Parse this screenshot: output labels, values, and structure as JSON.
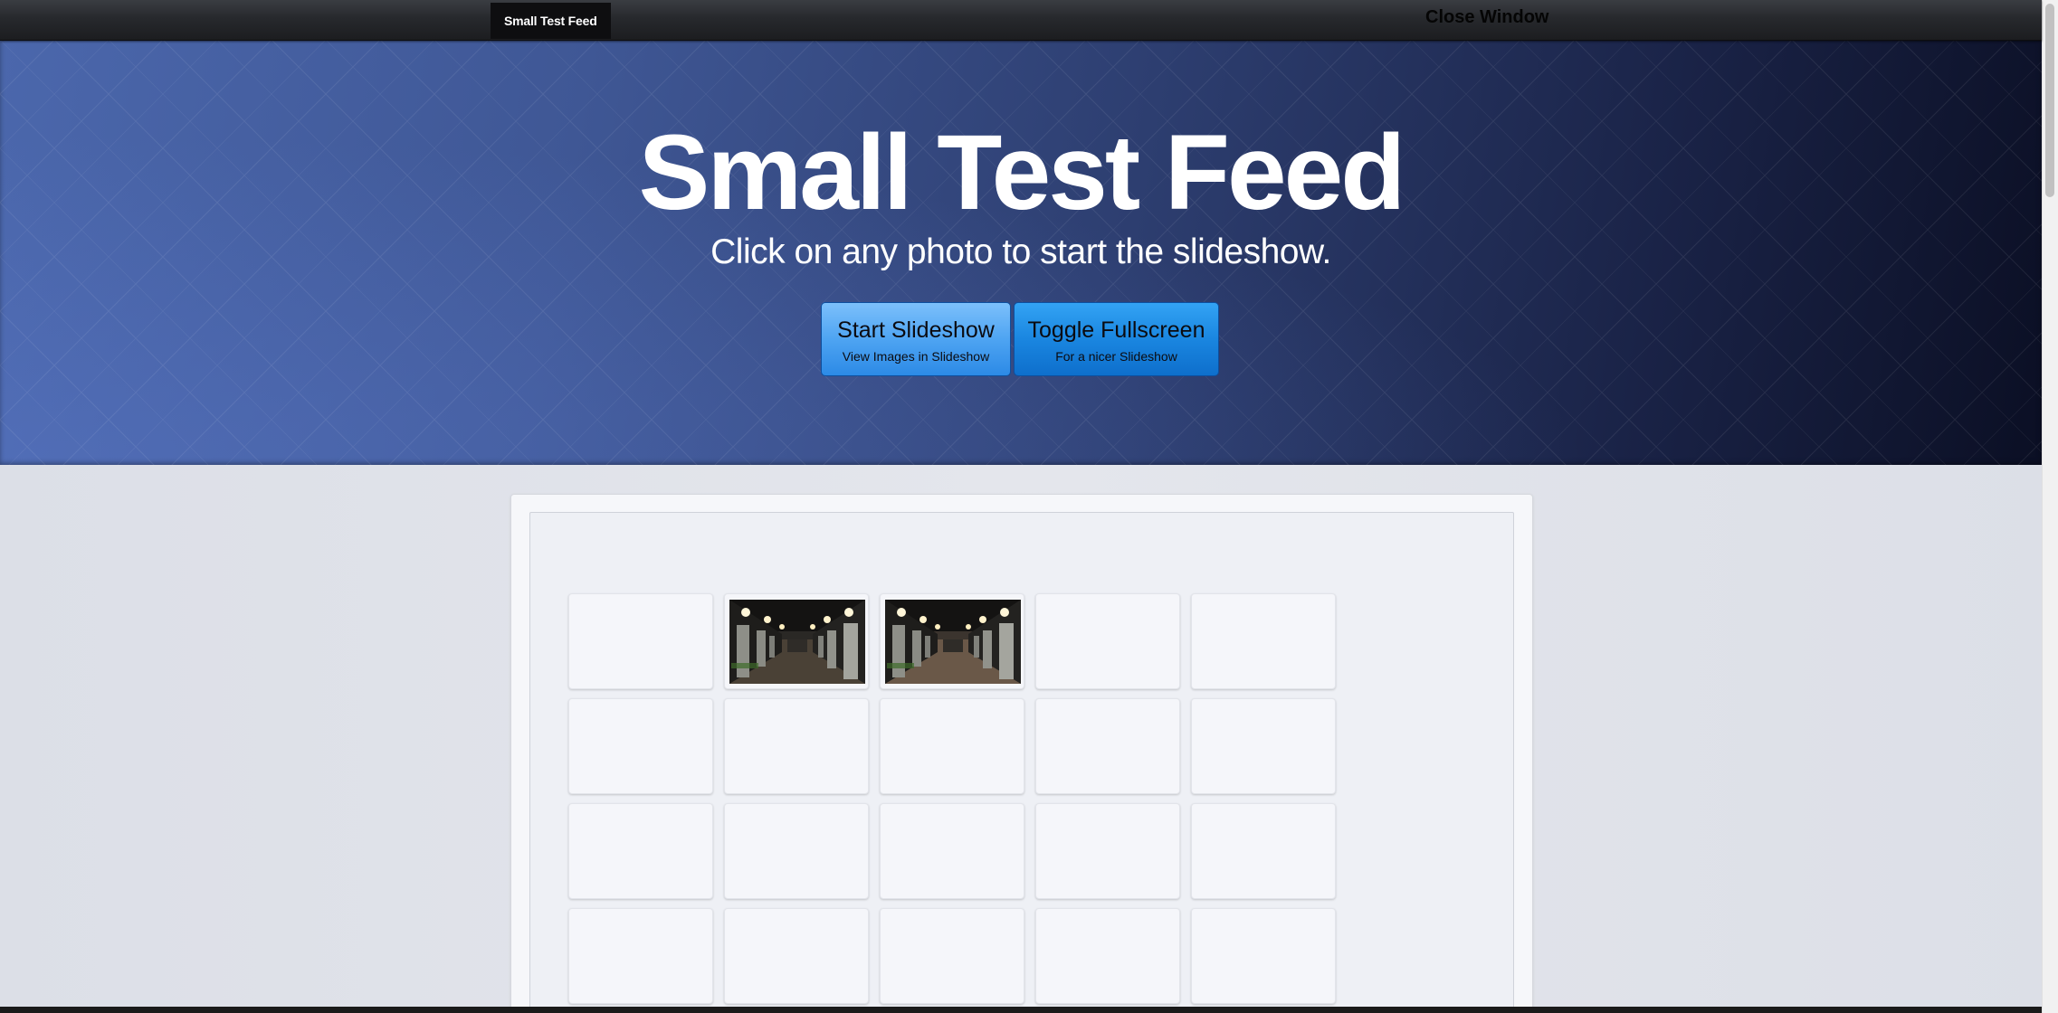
{
  "navbar": {
    "brand": "Small Test Feed",
    "close_label": "Close Window"
  },
  "hero": {
    "title": "Small Test Feed",
    "subtitle": "Click on any photo to start the slideshow.",
    "start_button": {
      "label": "Start Slideshow",
      "sublabel": "View Images in Slideshow"
    },
    "fullscreen_button": {
      "label": "Toggle Fullscreen",
      "sublabel": "For a nicer Slideshow"
    }
  },
  "gallery": {
    "rows": 4,
    "columns": 5,
    "loaded_photos": [
      {
        "row": 1,
        "column": 2,
        "subject": "corridor-photo"
      },
      {
        "row": 1,
        "column": 3,
        "subject": "corridor-photo"
      }
    ]
  },
  "colors": {
    "hero_start": "#4b67ac",
    "hero_end": "#0b0f24",
    "button_start": "#4ea4f2",
    "button_fullscreen": "#1a86e0",
    "navbar": "#27292d"
  }
}
